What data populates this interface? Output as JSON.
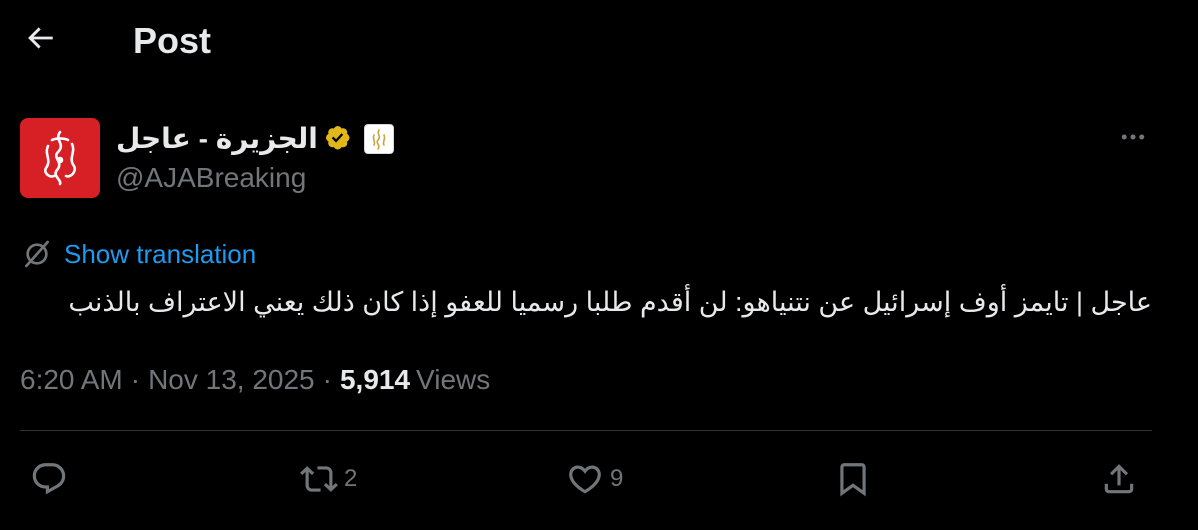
{
  "header": {
    "title": "Post"
  },
  "author": {
    "name": "الجزيرة - عاجل",
    "handle": "@AJABreaking",
    "verified": true,
    "avatar_color": "#d71f26"
  },
  "translation": {
    "link_label": "Show translation"
  },
  "tweet": {
    "text": "عاجل | تايمز أوف إسرائيل عن نتنياهو: لن أقدم طلبا رسميا للعفو إذا كان ذلك يعني الاعتراف بالذنب",
    "time": "6:20 AM",
    "date": "Nov 13, 2025",
    "separator": "·",
    "views_count": "5,914",
    "views_label": "Views"
  },
  "actions": {
    "reply_count": "",
    "repost_count": "2",
    "like_count": "9"
  },
  "colors": {
    "background": "#000000",
    "text": "#e7e9ea",
    "muted": "#71767b",
    "link": "#1d9bf0",
    "verified_gold": "#e2b719",
    "divider": "#2f3336"
  }
}
